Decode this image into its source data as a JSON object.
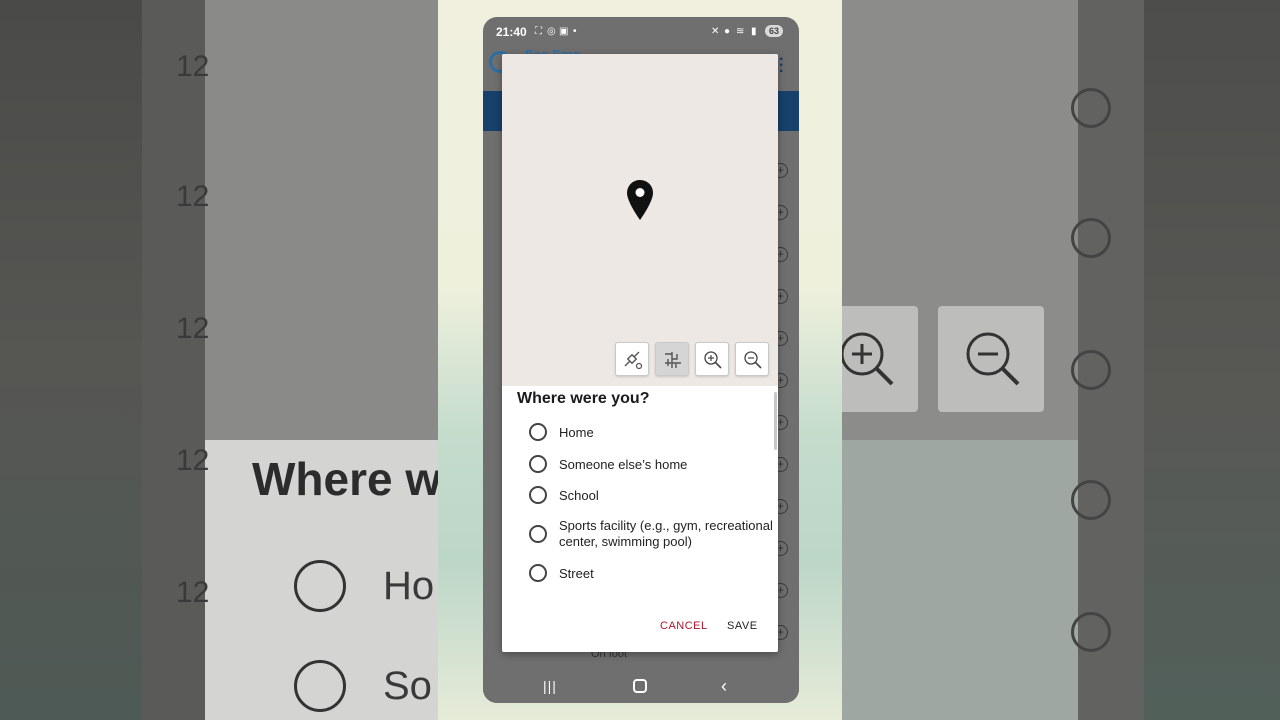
{
  "status_bar": {
    "time": "21:40",
    "battery": "63"
  },
  "app": {
    "name": "Eco Emo"
  },
  "dialog": {
    "map_controls": [
      {
        "icon": "satellite-icon"
      },
      {
        "icon": "map-layers-icon"
      },
      {
        "icon": "zoom-in-icon"
      },
      {
        "icon": "zoom-out-icon"
      }
    ],
    "question": "Where were you?",
    "options": [
      {
        "label": "Home"
      },
      {
        "label": "Someone else’s home"
      },
      {
        "label": "School"
      },
      {
        "label": "Sports facility (e.g., gym, recreational center, swimming pool)"
      },
      {
        "label": "Street"
      }
    ],
    "cancel_label": "CANCEL",
    "save_label": "SAVE"
  },
  "background_list": {
    "bottom_item_label": "On foot"
  },
  "backdrop": {
    "question_fragment": "Where w",
    "home_fragment": "Ho",
    "someone_fragment": "So"
  },
  "colors": {
    "primary_blue": "#17406b",
    "cancel_red": "#b0142f",
    "map_bg": "#ede8e4"
  }
}
